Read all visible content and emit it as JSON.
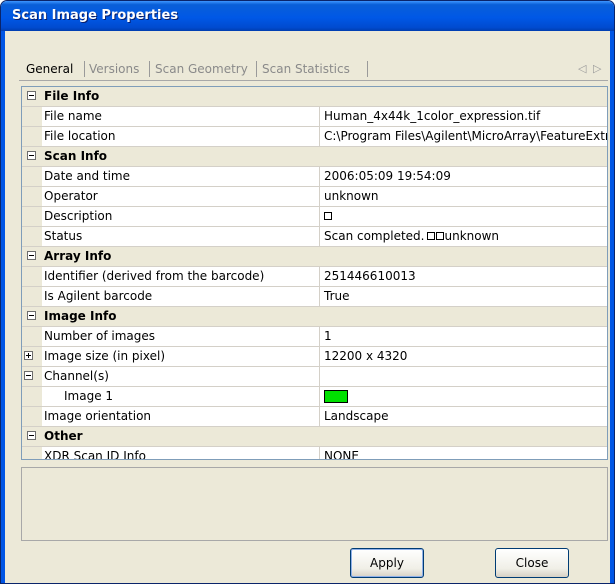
{
  "window": {
    "title": "Scan Image Properties"
  },
  "tabs": [
    {
      "label": "General",
      "active": true
    },
    {
      "label": "Versions",
      "active": false
    },
    {
      "label": "Scan Geometry",
      "active": false
    },
    {
      "label": "Scan Statistics",
      "active": false
    }
  ],
  "tab_scroll": {
    "left_icon": "chevron-left-icon",
    "left_glyph": "◁",
    "right_icon": "chevron-right-icon",
    "right_glyph": "▷"
  },
  "sections": {
    "file_info": {
      "title": "File Info",
      "file_name": {
        "label": "File name",
        "value": "Human_4x44k_1color_expression.tif"
      },
      "file_location": {
        "label": "File location",
        "value": "C:\\Program Files\\Agilent\\MicroArray\\FeatureExtr"
      }
    },
    "scan_info": {
      "title": "Scan Info",
      "date_time": {
        "label": "Date and time",
        "value": "2006:05:09 19:54:09"
      },
      "operator": {
        "label": "Operator",
        "value": "unknown"
      },
      "description": {
        "label": "Description",
        "value": ""
      },
      "status": {
        "label": "Status",
        "value_prefix": "Scan completed.",
        "value_suffix": "unknown"
      }
    },
    "array_info": {
      "title": "Array Info",
      "identifier": {
        "label": "Identifier (derived from the barcode)",
        "value": "251446610013"
      },
      "is_agilent": {
        "label": "Is Agilent barcode",
        "value": "True"
      }
    },
    "image_info": {
      "title": "Image Info",
      "num_images": {
        "label": "Number of images",
        "value": "1"
      },
      "image_size": {
        "label": "Image size (in pixel)",
        "value": "12200 x 4320"
      },
      "channels": {
        "label": "Channel(s)",
        "value": ""
      },
      "image1": {
        "label": "Image 1",
        "color": "#00e000"
      },
      "orientation": {
        "label": "Image orientation",
        "value": "Landscape"
      }
    },
    "other": {
      "title": "Other",
      "xdr": {
        "label": "XDR Scan ID Info",
        "value": "NONE"
      }
    }
  },
  "buttons": {
    "apply": "Apply",
    "close": "Close"
  },
  "colors": {
    "title_bar": "#0058e6",
    "window_bg": "#ece9d8",
    "grid_line": "#d4d0c8"
  }
}
